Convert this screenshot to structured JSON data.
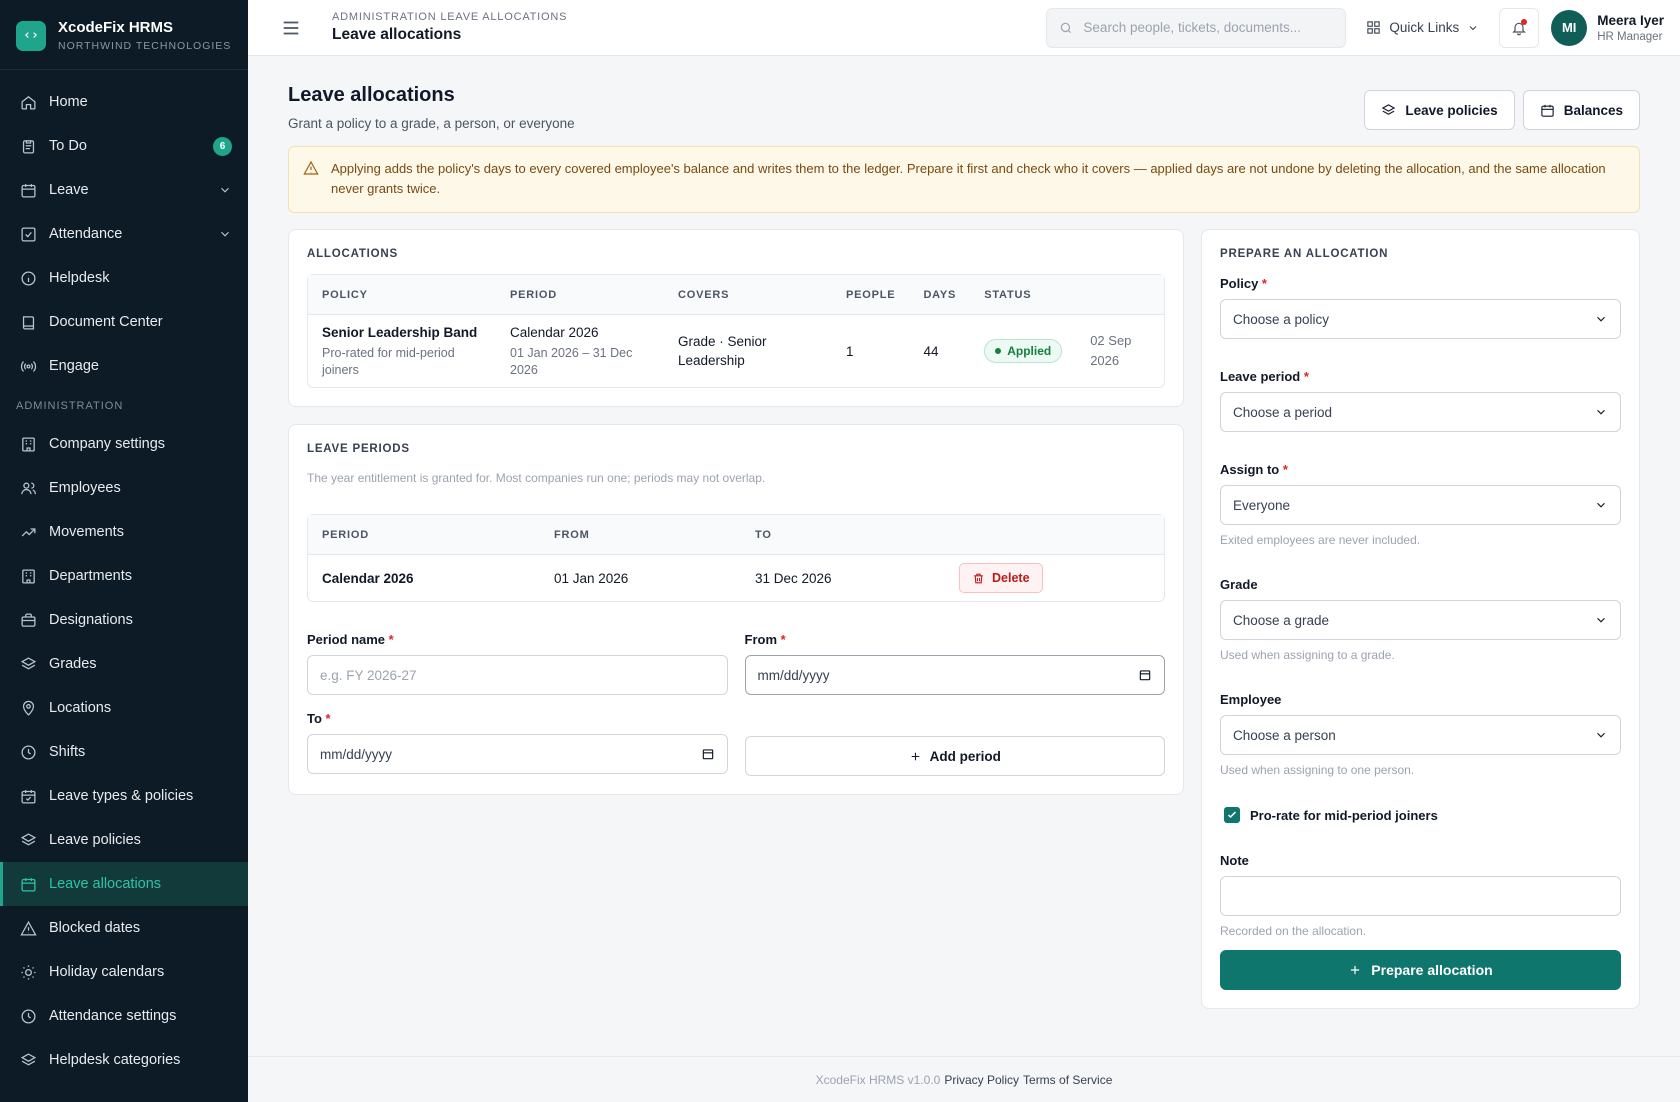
{
  "brand": {
    "name": "XcodeFix HRMS",
    "org": "NORTHWIND TECHNOLOGIES",
    "logo_icon": "code-icon"
  },
  "sidebar": {
    "items": [
      {
        "label": "Home",
        "icon": "home-icon"
      },
      {
        "label": "To Do",
        "icon": "clipboard-icon",
        "badge": "6"
      },
      {
        "label": "Leave",
        "icon": "calendar-icon",
        "expandable": true
      },
      {
        "label": "Attendance",
        "icon": "check-square-icon",
        "expandable": true
      },
      {
        "label": "Helpdesk",
        "icon": "info-icon"
      },
      {
        "label": "Document Center",
        "icon": "book-icon"
      },
      {
        "label": "Engage",
        "icon": "broadcast-icon"
      }
    ],
    "section_label": "ADMINISTRATION",
    "admin_items": [
      {
        "label": "Company settings",
        "icon": "building-icon"
      },
      {
        "label": "Employees",
        "icon": "users-icon"
      },
      {
        "label": "Movements",
        "icon": "trending-icon"
      },
      {
        "label": "Departments",
        "icon": "building-icon"
      },
      {
        "label": "Designations",
        "icon": "briefcase-icon"
      },
      {
        "label": "Grades",
        "icon": "layers-icon"
      },
      {
        "label": "Locations",
        "icon": "map-pin-icon"
      },
      {
        "label": "Shifts",
        "icon": "clock-icon"
      },
      {
        "label": "Leave types & policies",
        "icon": "calendar-check-icon"
      },
      {
        "label": "Leave policies",
        "icon": "layers-icon"
      },
      {
        "label": "Leave allocations",
        "icon": "calendar-icon",
        "active": true
      },
      {
        "label": "Blocked dates",
        "icon": "alert-triangle-icon"
      },
      {
        "label": "Holiday calendars",
        "icon": "sun-icon"
      },
      {
        "label": "Attendance settings",
        "icon": "clock-icon"
      },
      {
        "label": "Helpdesk categories",
        "icon": "layers-icon"
      }
    ]
  },
  "topbar": {
    "breadcrumb": "ADMINISTRATION LEAVE ALLOCATIONS",
    "title": "Leave allocations",
    "search_placeholder": "Search people, tickets, documents...",
    "quick_links": "Quick Links",
    "user": {
      "initials": "MI",
      "name": "Meera Iyer",
      "role": "HR Manager"
    }
  },
  "page": {
    "title": "Leave allocations",
    "subtitle": "Grant a policy to a grade, a person, or everyone",
    "btn_policies": "Leave policies",
    "btn_balances": "Balances",
    "alert": "Applying adds the policy's days to every covered employee's balance and writes them to the ledger. Prepare it first and check who it covers — applied days are not undone by deleting the allocation, and the same allocation never grants twice."
  },
  "allocations": {
    "title": "ALLOCATIONS",
    "headers": [
      "POLICY",
      "PERIOD",
      "COVERS",
      "PEOPLE",
      "DAYS",
      "STATUS",
      ""
    ],
    "rows": [
      {
        "policy": "Senior Leadership Band",
        "policy_note": "Pro-rated for mid-period joiners",
        "period": "Calendar 2026",
        "period_range": "01 Jan 2026 – 31 Dec 2026",
        "covers": "Grade · Senior Leadership",
        "people": "1",
        "days": "44",
        "status": "Applied",
        "date": "02 Sep 2026"
      }
    ]
  },
  "periods": {
    "title": "LEAVE PERIODS",
    "help": "The year entitlement is granted for. Most companies run one; periods may not overlap.",
    "headers": [
      "PERIOD",
      "FROM",
      "TO",
      ""
    ],
    "rows": [
      {
        "period": "Calendar 2026",
        "from": "01 Jan 2026",
        "to": "31 Dec 2026",
        "action": "Delete"
      }
    ],
    "form": {
      "name_label": "Period name",
      "name_placeholder": "e.g. FY 2026-27",
      "from_label": "From",
      "from_value": "mm/dd/yyyy",
      "to_label": "To",
      "to_value": "mm/dd/yyyy",
      "add_label": "Add period"
    }
  },
  "prepare": {
    "title": "PREPARE AN ALLOCATION",
    "policy_label": "Policy",
    "policy_value": "Choose a policy",
    "period_label": "Leave period",
    "period_value": "Choose a period",
    "assign_label": "Assign to",
    "assign_value": "Everyone",
    "assign_hint": "Exited employees are never included.",
    "grade_label": "Grade",
    "grade_value": "Choose a grade",
    "grade_hint": "Used when assigning to a grade.",
    "employee_label": "Employee",
    "employee_value": "Choose a person",
    "employee_hint": "Used when assigning to one person.",
    "prorate_label": "Pro-rate for mid-period joiners",
    "prorate_checked": true,
    "note_label": "Note",
    "note_value": "",
    "note_hint": "Recorded on the allocation.",
    "submit_label": "Prepare allocation"
  },
  "footer": {
    "version": "XcodeFix HRMS v1.0.0",
    "privacy": "Privacy Policy",
    "terms": "Terms of Service"
  },
  "colors": {
    "accent": "#0f766e",
    "sidebar_bg": "#0d1b26",
    "active_text": "#2fc3a6"
  }
}
